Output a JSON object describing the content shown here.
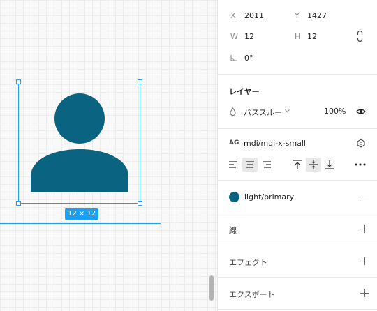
{
  "canvas": {
    "size_badge": "12 × 12",
    "icon_color": "#0b6382",
    "selection_color": "#18a0fb"
  },
  "transform": {
    "x_label": "X",
    "x_value": "2011",
    "y_label": "Y",
    "y_value": "1427",
    "w_label": "W",
    "w_value": "12",
    "h_label": "H",
    "h_value": "12",
    "rotation_value": "0°"
  },
  "layer": {
    "title": "レイヤー",
    "blend_mode": "パススルー",
    "opacity": "100%"
  },
  "text": {
    "component_name": "mdi/mdi-x-small",
    "align_options": [
      "left",
      "center",
      "right"
    ],
    "align_selected": "center",
    "vertical_options": [
      "top",
      "middle",
      "bottom"
    ],
    "vertical_selected": "middle"
  },
  "fill": {
    "style_name": "light/primary",
    "color": "#0b6382"
  },
  "stroke": {
    "title": "線"
  },
  "effects": {
    "title": "エフェクト"
  },
  "export": {
    "title": "エクスポート"
  }
}
